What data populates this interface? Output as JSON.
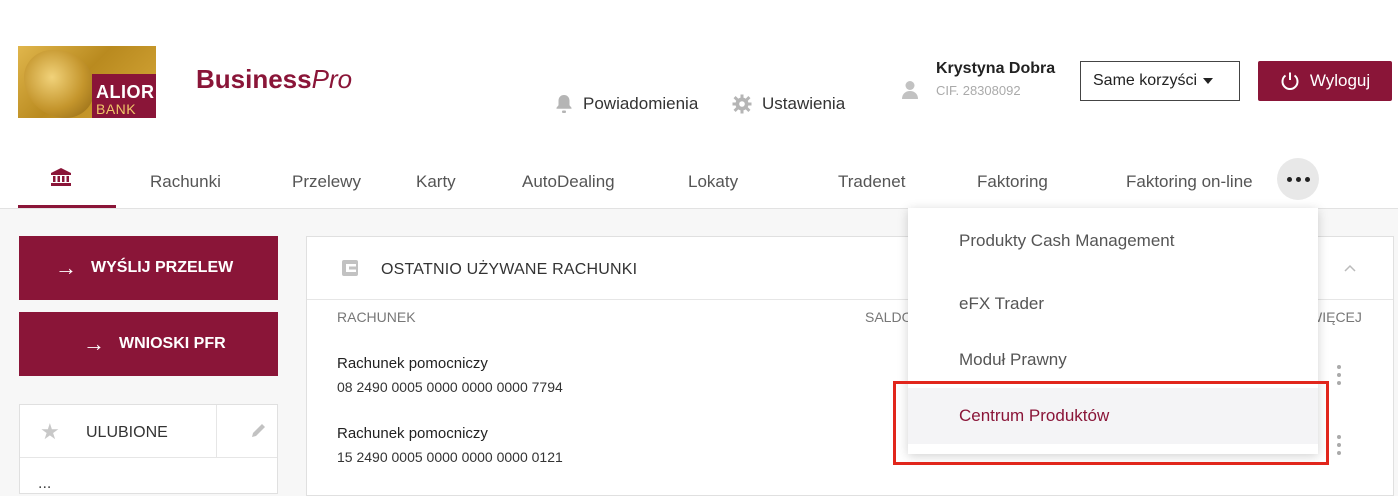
{
  "bank": {
    "name_line1": "ALIOR",
    "name_line2": "BANK"
  },
  "brand": {
    "bold": "Business",
    "italic": "Pro"
  },
  "header": {
    "notifications_label": "Powiadomienia",
    "settings_label": "Ustawienia",
    "user_name": "Krystyna Dobra",
    "user_cif": "CIF. 28308092",
    "profile_select": "Same korzyści",
    "logout_label": "Wyloguj"
  },
  "nav": {
    "items": [
      "Rachunki",
      "Przelewy",
      "Karty",
      "AutoDealing",
      "Lokaty",
      "Tradenet",
      "Faktoring",
      "Faktoring on-line"
    ]
  },
  "sidebar": {
    "send_transfer": "WYŚLIJ PRZELEW",
    "pfr_requests": "WNIOSKI PFR",
    "favorites_label": "ULUBIONE",
    "favorites_partial": "..."
  },
  "accounts_card": {
    "title": "OSTATNIO UŻYWANE RACHUNKI",
    "col_account": "RACHUNEK",
    "col_balance": "SALDO",
    "col_more": "WIĘCEJ",
    "rows": [
      {
        "name": "Rachunek pomocniczy",
        "number": "08 2490 0005 0000 0000 0000 7794"
      },
      {
        "name": "Rachunek pomocniczy",
        "number": "15 2490 0005 0000 0000 0000 0121"
      }
    ]
  },
  "more_menu": {
    "items": [
      "Produkty Cash Management",
      "eFX Trader",
      "Moduł Prawny",
      "Centrum Produktów"
    ],
    "highlighted": "Centrum Produktów"
  },
  "colors": {
    "brand": "#8a1538",
    "highlight": "#e1261c"
  }
}
